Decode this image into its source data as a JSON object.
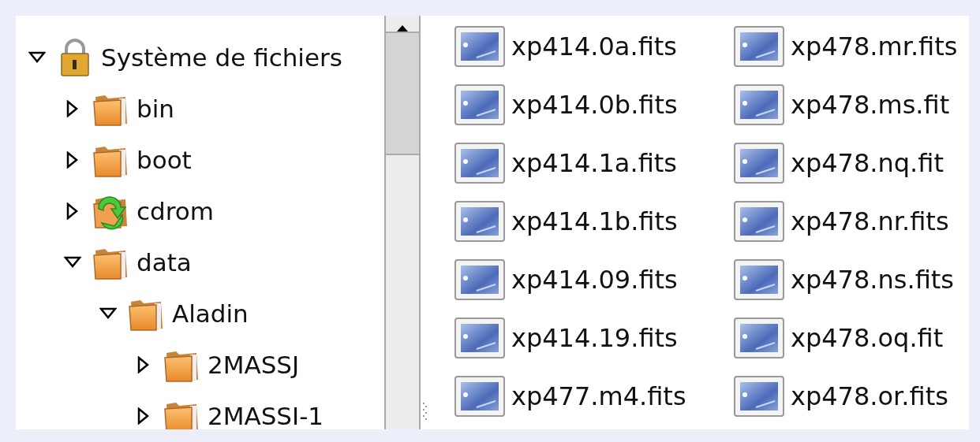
{
  "tree": [
    {
      "label": "Système de fichiers",
      "kind": "drive",
      "expanded": true,
      "children": [
        {
          "label": "bin",
          "kind": "folder",
          "expanded": false
        },
        {
          "label": "boot",
          "kind": "folder",
          "expanded": false
        },
        {
          "label": "cdrom",
          "kind": "cdrom",
          "expanded": false
        },
        {
          "label": "data",
          "kind": "folder",
          "expanded": true,
          "children": [
            {
              "label": "Aladin",
              "kind": "folder",
              "expanded": true,
              "children": [
                {
                  "label": "2MASSJ",
                  "kind": "folder",
                  "expanded": false
                },
                {
                  "label": "2MASSI-1",
                  "kind": "folder",
                  "expanded": false
                }
              ]
            }
          ]
        }
      ]
    }
  ],
  "files": [
    {
      "name": "xp414.0a.fits"
    },
    {
      "name": "xp478.mr.fits"
    },
    {
      "name": "xp414.0b.fits"
    },
    {
      "name": "xp478.ms.fit"
    },
    {
      "name": "xp414.1a.fits"
    },
    {
      "name": "xp478.nq.fit"
    },
    {
      "name": "xp414.1b.fits"
    },
    {
      "name": "xp478.nr.fits"
    },
    {
      "name": "xp414.09.fits"
    },
    {
      "name": "xp478.ns.fits"
    },
    {
      "name": "xp414.19.fits"
    },
    {
      "name": "xp478.oq.fit"
    },
    {
      "name": "xp477.m4.fits"
    },
    {
      "name": "xp478.or.fits"
    }
  ]
}
